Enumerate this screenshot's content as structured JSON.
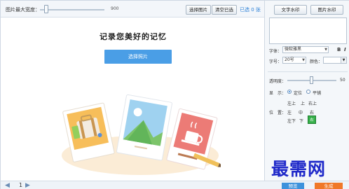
{
  "toolbar": {
    "max_width_label": "图片最大宽度：",
    "max_width_value": "900",
    "select_images_label": "选择图片",
    "clear_selected_label": "清空已选",
    "selected_count": "已选 0 张"
  },
  "canvas": {
    "headline": "记录您美好的记忆",
    "select_photos_label": "选择照片"
  },
  "panel": {
    "tabs": [
      "文字水印",
      "图片水印"
    ],
    "font_label": "字体：",
    "font_value": "微软雅黑",
    "size_label": "字号：",
    "size_value": "20号",
    "color_label": "颜色：",
    "opacity_label": "透明度：",
    "opacity_value": "50",
    "display_label": "显　示：",
    "display_options": [
      "定位",
      "平铺"
    ],
    "display_selected": "定位",
    "position_label": "位　置：",
    "positions": [
      [
        "左上",
        "上",
        "右上"
      ],
      [
        "左",
        "中",
        "右"
      ],
      [
        "左下",
        "下",
        "右下"
      ]
    ],
    "position_selected": "右下"
  },
  "bottom": {
    "page_number": "1",
    "preview_label": "预览",
    "generate_label": "生成"
  },
  "watermark_text": "最需网",
  "colors": {
    "accent_blue": "#4a9ee6",
    "generate_orange": "#f07828",
    "position_active_green": "#37b04a",
    "watermark_blue": "#1f29c9"
  }
}
